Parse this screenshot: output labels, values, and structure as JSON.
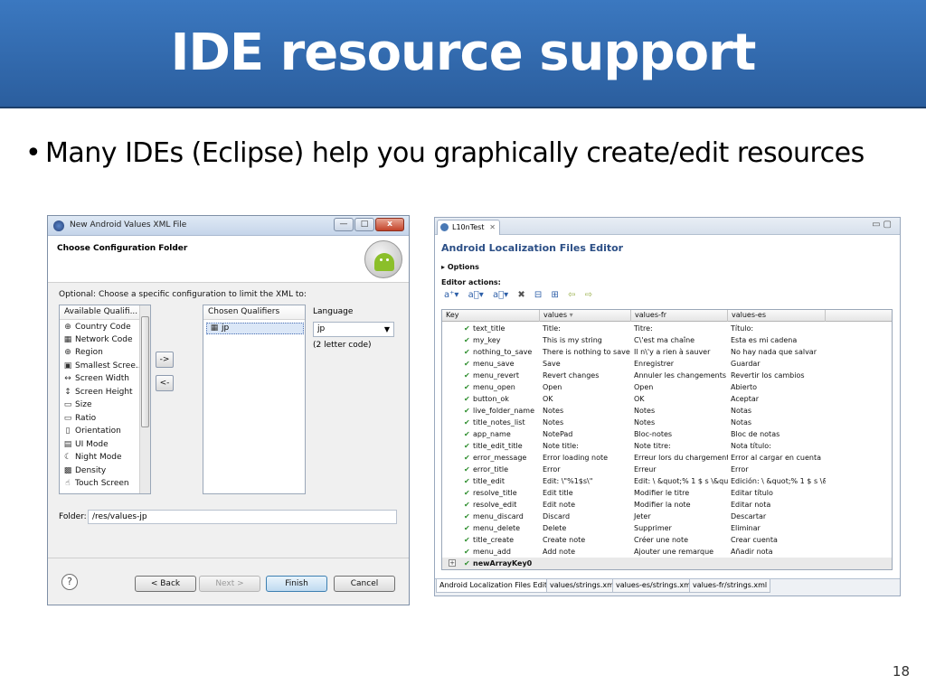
{
  "slide": {
    "title": "IDE resource support",
    "bullet_dot": "•",
    "bullet": "Many IDEs (Eclipse) help you graphically create/edit resources",
    "page_number": "18"
  },
  "dialog": {
    "window_title": "New Android Values XML File",
    "window_buttons": {
      "minimize": "—",
      "maximize": "□",
      "close": "x"
    },
    "header_title": "Choose Configuration Folder",
    "optional_text": "Optional: Choose a specific configuration to limit the XML to:",
    "available_header": "Available Qualifi...",
    "available_items": [
      {
        "label": "Country Code",
        "icon": "globe-icon"
      },
      {
        "label": "Network Code",
        "icon": "network-icon"
      },
      {
        "label": "Region",
        "icon": "region-icon"
      },
      {
        "label": "Smallest Scree...",
        "icon": "screen-icon"
      },
      {
        "label": "Screen Width",
        "icon": "width-icon"
      },
      {
        "label": "Screen Height",
        "icon": "height-icon"
      },
      {
        "label": "Size",
        "icon": "size-icon"
      },
      {
        "label": "Ratio",
        "icon": "ratio-icon"
      },
      {
        "label": "Orientation",
        "icon": "orientation-icon"
      },
      {
        "label": "UI Mode",
        "icon": "ui-mode-icon"
      },
      {
        "label": "Night Mode",
        "icon": "night-mode-icon"
      },
      {
        "label": "Density",
        "icon": "density-icon"
      },
      {
        "label": "Touch Screen",
        "icon": "touch-icon"
      }
    ],
    "add_button": "->",
    "remove_button": "<-",
    "chosen_header": "Chosen Qualifiers",
    "chosen_items": [
      "jp"
    ],
    "language_label": "Language",
    "language_value": "jp",
    "language_hint": "(2 letter code)",
    "folder_label": "Folder:",
    "folder_value": "/res/values-jp",
    "buttons": {
      "back": "< Back",
      "next": "Next >",
      "finish": "Finish",
      "cancel": "Cancel"
    }
  },
  "editor": {
    "tab_label": "L10nTest",
    "title": "Android Localization Files Editor",
    "options_label": "Options",
    "editor_actions_label": "Editor actions:",
    "columns": [
      "Key",
      "values",
      "values-fr",
      "values-es"
    ],
    "rows": [
      [
        "text_title",
        "Title:",
        "Titre:",
        "Título:"
      ],
      [
        "my_key",
        "This is my string",
        "C\\'est ma chaîne",
        "Esta es mi cadena"
      ],
      [
        "nothing_to_save",
        "There is nothing to save",
        "Il n\\'y a rien à sauver",
        "No hay nada que salvar"
      ],
      [
        "menu_save",
        "Save",
        "Enregistrer",
        "Guardar"
      ],
      [
        "menu_revert",
        "Revert changes",
        "Annuler les changements",
        "Revertir los cambios"
      ],
      [
        "menu_open",
        "Open",
        "Open",
        "Abierto"
      ],
      [
        "button_ok",
        "OK",
        "OK",
        "Aceptar"
      ],
      [
        "live_folder_name",
        "Notes",
        "Notes",
        "Notas"
      ],
      [
        "title_notes_list",
        "Notes",
        "Notes",
        "Notas"
      ],
      [
        "app_name",
        "NotePad",
        "Bloc-notes",
        "Bloc de notas"
      ],
      [
        "title_edit_title",
        "Note title:",
        "Note titre:",
        "Nota título:"
      ],
      [
        "error_message",
        "Error loading note",
        "Erreur lors du chargement n",
        "Error al cargar en cuenta"
      ],
      [
        "error_title",
        "Error",
        "Erreur",
        "Error"
      ],
      [
        "title_edit",
        "Edit: \\\"%1$s\\\"",
        "Edit: \\ &quot;% 1 $ s \\&quot",
        "Edición: \\ &quot;% 1 $ s \\&q"
      ],
      [
        "resolve_title",
        "Edit title",
        "Modifier le titre",
        "Editar título"
      ],
      [
        "resolve_edit",
        "Edit note",
        "Modifier la note",
        "Editar nota"
      ],
      [
        "menu_discard",
        "Discard",
        "Jeter",
        "Descartar"
      ],
      [
        "menu_delete",
        "Delete",
        "Supprimer",
        "Eliminar"
      ],
      [
        "title_create",
        "Create note",
        "Créer une note",
        "Crear cuenta"
      ],
      [
        "menu_add",
        "Add note",
        "Ajouter une remarque",
        "Añadir nota"
      ]
    ],
    "new_row_key": "newArrayKey0",
    "bottom_tabs": [
      "Android Localization Files Editor",
      "values/strings.xml",
      "values-es/strings.xml",
      "values-fr/strings.xml"
    ]
  }
}
